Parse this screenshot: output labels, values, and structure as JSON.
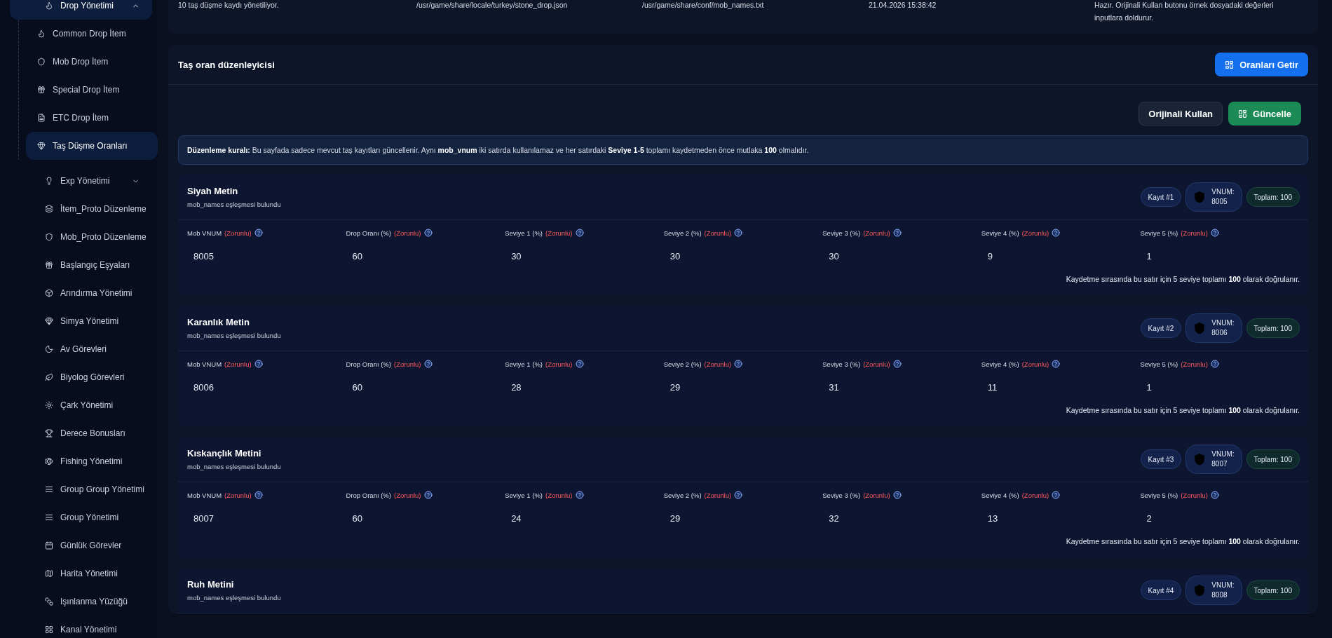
{
  "sidebar": {
    "items": [
      {
        "label": "Drop Yönetimi",
        "expanded": true,
        "children": [
          {
            "label": "Common Drop İtem",
            "selected": false
          },
          {
            "label": "Mob Drop İtem",
            "selected": false
          },
          {
            "label": "Special Drop İtem",
            "selected": false
          },
          {
            "label": "ETC Drop İtem",
            "selected": false
          },
          {
            "label": "Taş Düşme Oranları",
            "selected": true
          }
        ]
      },
      {
        "label": "Exp Yönetimi",
        "expanded": false
      },
      {
        "label": "İtem_Proto Düzenleme"
      },
      {
        "label": "Mob_Proto Düzenleme"
      },
      {
        "label": "Başlangıç Eşyaları"
      },
      {
        "label": "Arındırma Yönetimi"
      },
      {
        "label": "Simya Yönetimi"
      },
      {
        "label": "Av Görevleri"
      },
      {
        "label": "Biyolog Görevleri"
      },
      {
        "label": "Çark Yönetimi"
      },
      {
        "label": "Derece Bonusları"
      },
      {
        "label": "Fishing Yönetimi"
      },
      {
        "label": "Group Group Yönetimi"
      },
      {
        "label": "Group Yönetimi"
      },
      {
        "label": "Günlük Görevler"
      },
      {
        "label": "Harita Yönetimi"
      },
      {
        "label": "Işınlanma Yüzüğü"
      },
      {
        "label": "Kanal Yönetimi"
      }
    ]
  },
  "summary": {
    "cells": [
      "10 taş düşme kaydı yönetiliyor.",
      "/usr/game/share/locale/turkey/stone_drop.json",
      "/usr/game/share/conf/mob_names.txt",
      "21.04.2026 15:38:42",
      "Hazır. Orijinali Kullan butonu örnek dosyadaki değerleri inputlara doldurur."
    ]
  },
  "editor": {
    "title": "Taş oran düzenleyicisi",
    "fetch_button": "Oranları Getir",
    "original_button": "Orijinali Kullan",
    "update_button": "Güncelle",
    "rule": "**Düzenleme kuralı:** Bu sayfada sadece mevcut taş kayıtları güncellenir. Aynı **mob_vnum** iki satırda kullanılamaz ve her satırdaki **Seviye 1-5** toplamı kaydetmeden önce mutlaka **100** olmalıdır.",
    "records": [
      {
        "name": "Siyah Metin",
        "subtitle": "mob_names eşleşmesi bulundu",
        "record": "Kayıt #1",
        "vnum_label": "VNUM:",
        "vnum": "8005",
        "total": "Toplam: 100",
        "fields": [
          {
            "label": "Mob VNUM",
            "required": "(Zorunlu)",
            "value": "8005"
          },
          {
            "label": "Drop Oranı (%)",
            "required": "(Zorunlu)",
            "value": "60"
          },
          {
            "label": "Seviye 1 (%)",
            "required": "(Zorunlu)",
            "value": "30"
          },
          {
            "label": "Seviye 2 (%)",
            "required": "(Zorunlu)",
            "value": "30"
          },
          {
            "label": "Seviye 3 (%)",
            "required": "(Zorunlu)",
            "value": "30"
          },
          {
            "label": "Seviye 4 (%)",
            "required": "(Zorunlu)",
            "value": "9"
          },
          {
            "label": "Seviye 5 (%)",
            "required": "(Zorunlu)",
            "value": "1"
          }
        ],
        "note": "Kaydetme sırasında bu satır için 5 seviye toplamı **100** olarak doğrulanır."
      },
      {
        "name": "Karanlık Metin",
        "subtitle": "mob_names eşleşmesi bulundu",
        "record": "Kayıt #2",
        "vnum_label": "VNUM:",
        "vnum": "8006",
        "total": "Toplam: 100",
        "fields": [
          {
            "label": "Mob VNUM",
            "required": "(Zorunlu)",
            "value": "8006"
          },
          {
            "label": "Drop Oranı (%)",
            "required": "(Zorunlu)",
            "value": "60"
          },
          {
            "label": "Seviye 1 (%)",
            "required": "(Zorunlu)",
            "value": "28"
          },
          {
            "label": "Seviye 2 (%)",
            "required": "(Zorunlu)",
            "value": "29"
          },
          {
            "label": "Seviye 3 (%)",
            "required": "(Zorunlu)",
            "value": "31"
          },
          {
            "label": "Seviye 4 (%)",
            "required": "(Zorunlu)",
            "value": "11"
          },
          {
            "label": "Seviye 5 (%)",
            "required": "(Zorunlu)",
            "value": "1"
          }
        ],
        "note": "Kaydetme sırasında bu satır için 5 seviye toplamı **100** olarak doğrulanır."
      },
      {
        "name": "Kıskançlık Metini",
        "subtitle": "mob_names eşleşmesi bulundu",
        "record": "Kayıt #3",
        "vnum_label": "VNUM:",
        "vnum": "8007",
        "total": "Toplam: 100",
        "fields": [
          {
            "label": "Mob VNUM",
            "required": "(Zorunlu)",
            "value": "8007"
          },
          {
            "label": "Drop Oranı (%)",
            "required": "(Zorunlu)",
            "value": "60"
          },
          {
            "label": "Seviye 1 (%)",
            "required": "(Zorunlu)",
            "value": "24"
          },
          {
            "label": "Seviye 2 (%)",
            "required": "(Zorunlu)",
            "value": "29"
          },
          {
            "label": "Seviye 3 (%)",
            "required": "(Zorunlu)",
            "value": "32"
          },
          {
            "label": "Seviye 4 (%)",
            "required": "(Zorunlu)",
            "value": "13"
          },
          {
            "label": "Seviye 5 (%)",
            "required": "(Zorunlu)",
            "value": "2"
          }
        ],
        "note": "Kaydetme sırasında bu satır için 5 seviye toplamı **100** olarak doğrulanır."
      },
      {
        "name": "Ruh Metini",
        "subtitle": "mob_names eşleşmesi bulundu",
        "record": "Kayıt #4",
        "vnum_label": "VNUM:",
        "vnum": "8008",
        "total": "Toplam: 100"
      }
    ]
  }
}
